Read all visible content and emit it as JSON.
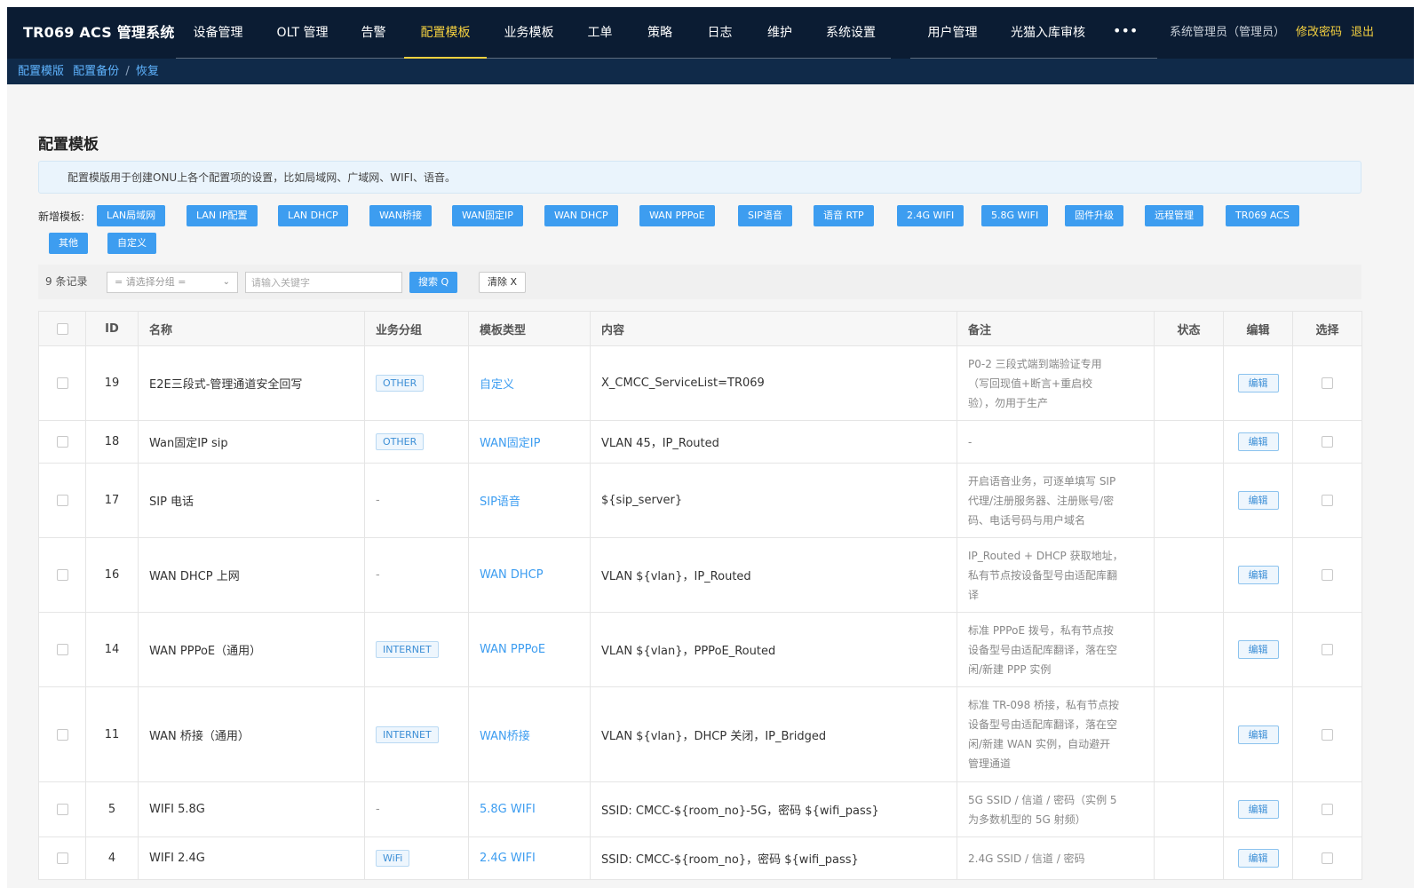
{
  "app": {
    "title": "TR069 ACS 管理系统"
  },
  "nav": {
    "items": [
      "设备管理",
      "OLT 管理",
      "告警",
      "配置模板",
      "业务模板",
      "工单",
      "策略",
      "日志",
      "维护",
      "系统设置"
    ],
    "items_right": [
      "用户管理",
      "光猫入库审核"
    ],
    "more": "•••",
    "active": "配置模板",
    "user": "系统管理员（管理员）",
    "change_password": "修改密码",
    "logout": "退出"
  },
  "subnav": {
    "item1": "配置模版",
    "item2": "配置备份",
    "sep": "/",
    "item3": "恢复"
  },
  "page": {
    "title": "配置模板",
    "info": "配置模版用于创建ONU上各个配置项的设置，比如局域网、广域网、WIFI、语音。",
    "add_label": "新增模板:"
  },
  "template_buttons": [
    "LAN局域网",
    "LAN IP配置",
    "LAN DHCP",
    "WAN桥接",
    "WAN固定IP",
    "WAN DHCP",
    "WAN PPPoE",
    "SIP语音",
    "语音 RTP",
    "2.4G WIFI",
    "5.8G WIFI",
    "固件升级",
    "远程管理",
    "TR069 ACS",
    "其他",
    "自定义"
  ],
  "toolbar": {
    "records": "9 条记录",
    "group_placeholder": "= 请选择分组 =",
    "keyword_placeholder": "请输入关键字",
    "search": "搜索 Q",
    "clear": "清除 X"
  },
  "table": {
    "columns": [
      "ID",
      "名称",
      "业务分组",
      "模板类型",
      "内容",
      "备注",
      "状态",
      "编辑",
      "选择"
    ],
    "edit_label": "编辑",
    "rows": [
      {
        "id": "19",
        "name": "E2E三段式-管理通道安全回写",
        "group": "OTHER",
        "type": "自定义",
        "content": "X_CMCC_ServiceList=TR069",
        "note": [
          "P0-2 三段式端到端验证专用",
          "（写回现值+断言+重启校",
          "验），勿用于生产"
        ]
      },
      {
        "id": "18",
        "name": "Wan固定IP sip",
        "group": "OTHER",
        "type": "WAN固定IP",
        "content": "VLAN 45，IP_Routed",
        "note": [
          "-"
        ]
      },
      {
        "id": "17",
        "name": "SIP 电话",
        "group": "-",
        "type": "SIP语音",
        "content": "${sip_server}",
        "note": [
          "开启语音业务，可逐单填写 SIP",
          "代理/注册服务器、注册账号/密",
          "码、电话号码与用户域名"
        ]
      },
      {
        "id": "16",
        "name": "WAN DHCP 上网",
        "group": "-",
        "type": "WAN DHCP",
        "content": "VLAN ${vlan}，IP_Routed",
        "note": [
          "IP_Routed + DHCP 获取地址，",
          "私有节点按设备型号由适配库翻",
          "译"
        ]
      },
      {
        "id": "14",
        "name": "WAN PPPoE（通用）",
        "group": "INTERNET",
        "type": "WAN PPPoE",
        "content": "VLAN ${vlan}，PPPoE_Routed",
        "note": [
          "标准 PPPoE 拨号，私有节点按",
          "设备型号由适配库翻译，落在空",
          "闲/新建 PPP 实例"
        ]
      },
      {
        "id": "11",
        "name": "WAN 桥接（通用）",
        "group": "INTERNET",
        "type": "WAN桥接",
        "content": "VLAN ${vlan}，DHCP 关闭，IP_Bridged",
        "note": [
          "标准 TR-098 桥接，私有节点按",
          "设备型号由适配库翻译，落在空",
          "闲/新建 WAN 实例，自动避开",
          "管理通道"
        ]
      },
      {
        "id": "5",
        "name": "WIFI 5.8G",
        "group": "-",
        "type": "5.8G WIFI",
        "content": "SSID: CMCC-${room_no}-5G，密码 ${wifi_pass}",
        "note": [
          "5G SSID / 信道 / 密码（实例 5",
          "为多数机型的 5G 射频）"
        ]
      },
      {
        "id": "4",
        "name": "WIFI 2.4G",
        "group": "WiFi",
        "type": "2.4G WIFI",
        "content": "SSID: CMCC-${room_no}，密码 ${wifi_pass}",
        "note": [
          "2.4G SSID / 信道 / 密码"
        ]
      }
    ]
  },
  "colors": {
    "nav_bg": "#0b1c33",
    "subnav_bg": "#102a49",
    "accent": "#f4d03f",
    "primary": "#3d9df0",
    "link": "#5fb4ff"
  }
}
